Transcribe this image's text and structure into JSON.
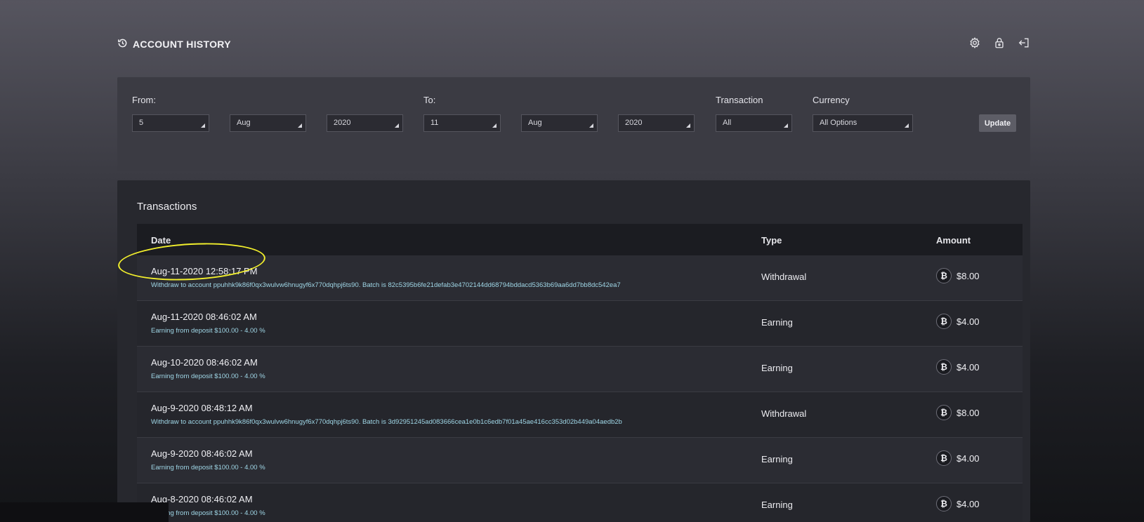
{
  "header": {
    "title": "ACCOUNT HISTORY",
    "icons": [
      "history-icon",
      "gear-icon",
      "lock-icon",
      "logout-icon"
    ]
  },
  "filters": {
    "from_label": "From:",
    "from_day": "5",
    "from_month": "Aug",
    "from_year": "2020",
    "to_label": "To:",
    "to_day": "11",
    "to_month": "Aug",
    "to_year": "2020",
    "transaction_label": "Transaction",
    "transaction_value": "All",
    "currency_label": "Currency",
    "currency_value": "All Options",
    "update_label": "Update"
  },
  "transactions": {
    "heading": "Transactions",
    "columns": {
      "date": "Date",
      "type": "Type",
      "amount": "Amount"
    },
    "currency_icon": "bitcoin-icon",
    "rows": [
      {
        "date": "Aug-11-2020 12:58:17 PM",
        "desc": "Withdraw to account ppuhhk9k86f0qx3wulvw6hnugyf6x770dqhpj6ts90. Batch is 82c5395b6fe21defab3e4702144dd68794bddacd5363b69aa6dd7bb8dc542ea7",
        "type": "Withdrawal",
        "amount": "$8.00"
      },
      {
        "date": "Aug-11-2020 08:46:02 AM",
        "desc": "Earning from deposit $100.00 - 4.00 %",
        "type": "Earning",
        "amount": "$4.00"
      },
      {
        "date": "Aug-10-2020 08:46:02 AM",
        "desc": "Earning from deposit $100.00 - 4.00 %",
        "type": "Earning",
        "amount": "$4.00"
      },
      {
        "date": "Aug-9-2020 08:48:12 AM",
        "desc": "Withdraw to account ppuhhk9k86f0qx3wulvw6hnugyf6x770dqhpj6ts90. Batch is 3d92951245ad083666cea1e0b1c6edb7f01a45ae416cc353d02b449a04aedb2b",
        "type": "Withdrawal",
        "amount": "$8.00"
      },
      {
        "date": "Aug-9-2020 08:46:02 AM",
        "desc": "Earning from deposit $100.00 - 4.00 %",
        "type": "Earning",
        "amount": "$4.00"
      },
      {
        "date": "Aug-8-2020 08:46:02 AM",
        "desc": "Earning from deposit $100.00 - 4.00 %",
        "type": "Earning",
        "amount": "$4.00"
      }
    ]
  },
  "colors": {
    "highlight": "#f2ef2c",
    "desc_text": "#9fd6e6"
  }
}
